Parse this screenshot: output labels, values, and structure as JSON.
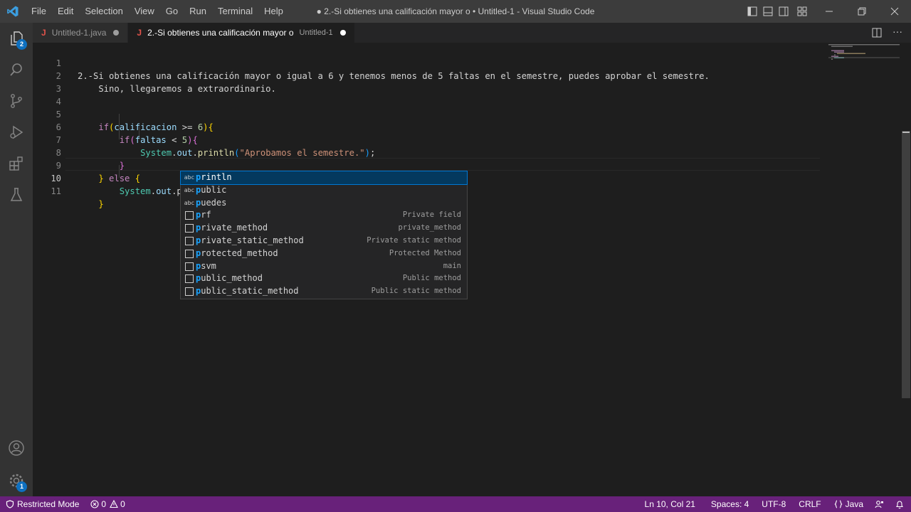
{
  "window": {
    "title": "● 2.-Si obtienes una calificación mayor o • Untitled-1 - Visual Studio Code"
  },
  "menu": {
    "items": [
      "File",
      "Edit",
      "Selection",
      "View",
      "Go",
      "Run",
      "Terminal",
      "Help"
    ]
  },
  "activity_bar": {
    "items": [
      "explorer-icon",
      "search-icon",
      "source-control-icon",
      "run-debug-icon",
      "extensions-icon",
      "testing-icon"
    ],
    "explorer_badge": "2",
    "bottom_items": [
      "accounts-icon",
      "manage-gear-icon"
    ],
    "manage_badge": "1"
  },
  "tabs": [
    {
      "icon": "J",
      "label": "Untitled-1.java",
      "description": "",
      "active": false,
      "dirty": true
    },
    {
      "icon": "J",
      "label": "2.-Si obtienes una calificación mayor o",
      "description": "Untitled-1",
      "active": true,
      "dirty": true
    }
  ],
  "editor": {
    "current_line": 10,
    "line_numbers": [
      "1",
      "2",
      "3",
      "4",
      "5",
      "6",
      "7",
      "8",
      "9",
      "10",
      "11"
    ],
    "lines": [
      "2.-Si obtienes una calificación mayor o igual a 6 y tenemos menos de 5 faltas en el semestre, puedes aprobar el semestre.",
      "    Sino, llegaremos a extraordinario.",
      "",
      "",
      "    if(calificacion >= 6){",
      "        if(faltas < 5){",
      "            System.out.println(\"Aprobamos el semestre.\");",
      "        }",
      "    } else {",
      "        System.out.p",
      "    }"
    ]
  },
  "suggest": {
    "items": [
      {
        "kind": "abc",
        "match": "p",
        "rest": "rintln",
        "detail": "",
        "selected": true
      },
      {
        "kind": "abc",
        "match": "p",
        "rest": "ublic",
        "detail": "",
        "selected": false
      },
      {
        "kind": "abc",
        "match": "p",
        "rest": "uedes",
        "detail": "",
        "selected": false
      },
      {
        "kind": "snippet",
        "match": "p",
        "rest": "rf",
        "detail": "Private field",
        "selected": false
      },
      {
        "kind": "snippet",
        "match": "p",
        "rest": "rivate_method",
        "detail": "private_method",
        "selected": false
      },
      {
        "kind": "snippet",
        "match": "p",
        "rest": "rivate_static_method",
        "detail": "Private static method",
        "selected": false
      },
      {
        "kind": "snippet",
        "match": "p",
        "rest": "rotected_method",
        "detail": "Protected Method",
        "selected": false
      },
      {
        "kind": "snippet",
        "match": "p",
        "rest": "svm",
        "detail": "main",
        "selected": false
      },
      {
        "kind": "snippet",
        "match": "p",
        "rest": "ublic_method",
        "detail": "Public method",
        "selected": false
      },
      {
        "kind": "snippet",
        "match": "p",
        "rest": "ublic_static_method",
        "detail": "Public static method",
        "selected": false
      }
    ]
  },
  "status": {
    "restricted_mode": "Restricted Mode",
    "errors": "0",
    "warnings": "0",
    "position": "Ln 10, Col 21",
    "spaces": "Spaces: 4",
    "encoding": "UTF-8",
    "eol": "CRLF",
    "language": "Java"
  },
  "colors": {
    "status_bar": "#68217a",
    "title_bar": "#3c3c3c",
    "activity_bar": "#333333",
    "editor_bg": "#1e1e1e",
    "suggest_selected": "#04395e",
    "match_highlight": "#18a3ff"
  }
}
